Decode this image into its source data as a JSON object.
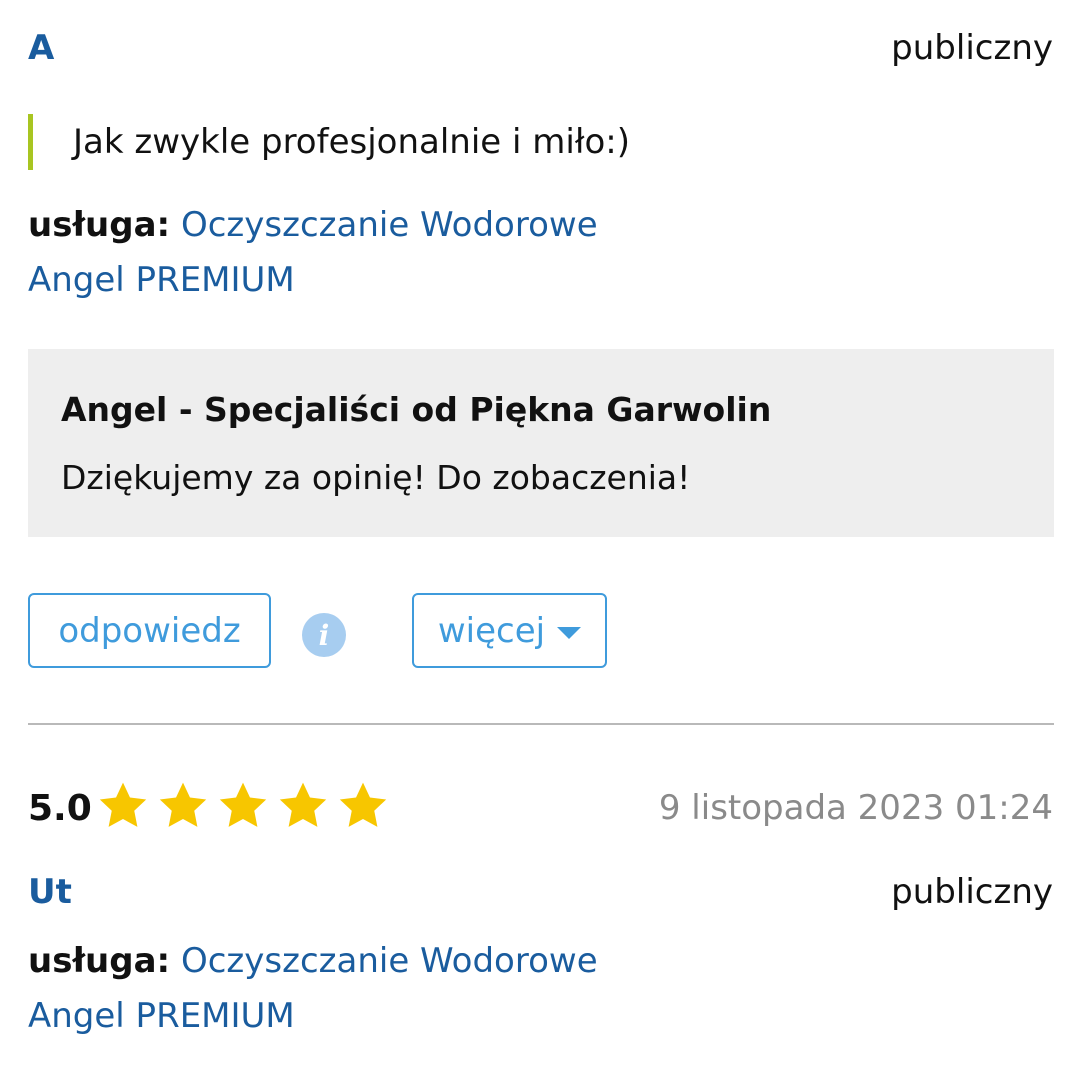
{
  "review1": {
    "author": "A",
    "visibility": "publiczny",
    "comment": "Jak zwykle profesjonalnie i miło:)",
    "service_label": "usługa:",
    "service_name": "Oczyszczanie Wodorowe",
    "service_variant": "Angel PREMIUM",
    "reply": {
      "author": "Angel - Specjaliści od Piękna Garwolin",
      "text": "Dziękujemy za opinię! Do zobaczenia!"
    },
    "actions": {
      "reply_label": "odpowiedz",
      "info_icon": "info-icon",
      "more_label": "więcej",
      "more_icon": "caret-down-icon"
    }
  },
  "review2": {
    "rating": "5.0",
    "stars": 5,
    "max_stars": 5,
    "date": "9 listopada 2023 01:24",
    "author": "Ut",
    "visibility": "publiczny",
    "service_label": "usługa:",
    "service_name": "Oczyszczanie Wodorowe",
    "service_variant": "Angel PREMIUM"
  },
  "colors": {
    "link": "#1a5c9e",
    "button": "#3f9bdc",
    "quote_bar": "#a8c521",
    "star": "#f7c600",
    "reply_bg": "#eeeeee",
    "date": "#8a8a8a"
  }
}
